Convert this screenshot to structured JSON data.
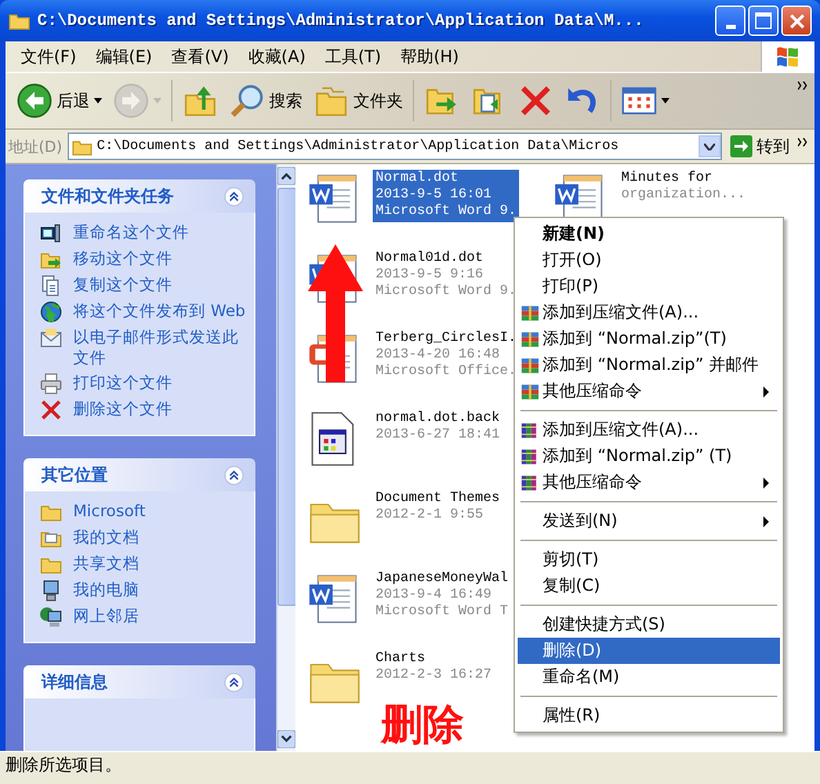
{
  "window": {
    "title": "C:\\Documents and Settings\\Administrator\\Application Data\\M..."
  },
  "menu_bar": [
    "文件(F)",
    "编辑(E)",
    "查看(V)",
    "收藏(A)",
    "工具(T)",
    "帮助(H)"
  ],
  "toolbar": [
    {
      "kind": "back",
      "label": "后退",
      "disabled": false
    },
    {
      "kind": "forward",
      "disabled": true
    },
    {
      "kind": "up",
      "disabled": false
    },
    {
      "kind": "search",
      "label": "搜索",
      "disabled": false
    },
    {
      "kind": "folders",
      "label": "文件夹",
      "disabled": false
    },
    {
      "kind": "move",
      "disabled": false
    },
    {
      "kind": "copy",
      "disabled": false
    },
    {
      "kind": "delete",
      "disabled": false
    },
    {
      "kind": "undo",
      "disabled": false
    },
    {
      "kind": "views",
      "disabled": false
    }
  ],
  "address_bar": {
    "label": "地址(D)",
    "value": "C:\\Documents and Settings\\Administrator\\Application Data\\Micros",
    "go": "转到"
  },
  "task_panels": [
    {
      "title": "文件和文件夹任务",
      "items": [
        "重命名这个文件",
        "移动这个文件",
        "复制这个文件",
        "将这个文件发布到 Web",
        "以电子邮件形式发送此文件",
        "打印这个文件",
        "删除这个文件"
      ]
    },
    {
      "title": "其它位置",
      "items": [
        "Microsoft",
        "我的文档",
        "共享文档",
        "我的电脑",
        "网上邻居"
      ]
    },
    {
      "title": "详细信息"
    }
  ],
  "files": [
    {
      "kind": "word",
      "lines": [
        "Normal.dot",
        "2013-9-5 16:01",
        "Microsoft Word 9."
      ],
      "selected": true
    },
    {
      "kind": "word",
      "lines": [
        "Normal01d.dot",
        "2013-9-5 9:16",
        "Microsoft Word 9."
      ],
      "selected": false
    },
    {
      "kind": "office",
      "lines": [
        "Terberg_CirclesI.",
        "2013-4-20 16:48",
        "Microsoft Office."
      ],
      "selected": false
    },
    {
      "kind": "file",
      "lines": [
        "normal.dot.back",
        "2013-6-27 18:41"
      ],
      "selected": false
    },
    {
      "kind": "folder",
      "lines": [
        "Document Themes",
        "2012-2-1 9:55"
      ],
      "selected": false
    },
    {
      "kind": "word",
      "lines": [
        "JapaneseMoneyWal",
        "2013-9-4 16:49",
        "Microsoft Word T"
      ],
      "selected": false
    },
    {
      "kind": "folder",
      "lines": [
        "Charts",
        "2012-2-3 16:27"
      ],
      "selected": false
    },
    {
      "kind": "word",
      "lines": [
        "Minutes for",
        "organization..."
      ],
      "selected": false
    }
  ],
  "context_menu": [
    {
      "kind": "item",
      "label": "新建(N)",
      "bold": true,
      "submenu": false,
      "selected": false
    },
    {
      "kind": "item",
      "label": "打开(O)",
      "bold": false,
      "submenu": false,
      "selected": false
    },
    {
      "kind": "item",
      "label": "打印(P)",
      "bold": false,
      "submenu": false,
      "selected": false
    },
    {
      "kind": "archive-item",
      "label": "添加到压缩文件(A)...",
      "bold": false,
      "submenu": false,
      "selected": false
    },
    {
      "kind": "archive-item",
      "label": "添加到 “Normal.zip”(T)",
      "bold": false,
      "submenu": false,
      "selected": false
    },
    {
      "kind": "archive-item",
      "label": "添加到 “Normal.zip” 并邮件",
      "bold": false,
      "submenu": false,
      "selected": false
    },
    {
      "kind": "archive-item",
      "label": "其他压缩命令",
      "bold": false,
      "submenu": true,
      "selected": false
    },
    {
      "kind": "separator"
    },
    {
      "kind": "books-item",
      "label": "添加到压缩文件(A)...",
      "bold": false,
      "submenu": false,
      "selected": false
    },
    {
      "kind": "books-item",
      "label": "添加到 “Normal.zip” (T)",
      "bold": false,
      "submenu": false,
      "selected": false
    },
    {
      "kind": "books-item",
      "label": "其他压缩命令",
      "bold": false,
      "submenu": true,
      "selected": false
    },
    {
      "kind": "separator"
    },
    {
      "kind": "item",
      "label": "发送到(N)",
      "bold": false,
      "submenu": true,
      "selected": false
    },
    {
      "kind": "separator"
    },
    {
      "kind": "item",
      "label": "剪切(T)",
      "bold": false,
      "submenu": false,
      "selected": false
    },
    {
      "kind": "item",
      "label": "复制(C)",
      "bold": false,
      "submenu": false,
      "selected": false
    },
    {
      "kind": "separator"
    },
    {
      "kind": "item",
      "label": "创建快捷方式(S)",
      "bold": false,
      "submenu": false,
      "selected": false
    },
    {
      "kind": "item",
      "label": "删除(D)",
      "bold": false,
      "submenu": false,
      "selected": true
    },
    {
      "kind": "item",
      "label": "重命名(M)",
      "bold": false,
      "submenu": false,
      "selected": false
    },
    {
      "kind": "separator"
    },
    {
      "kind": "item",
      "label": "属性(R)",
      "bold": false,
      "submenu": false,
      "selected": false
    }
  ],
  "annotation": {
    "label": "删除"
  },
  "status_bar": "删除所选项目。"
}
